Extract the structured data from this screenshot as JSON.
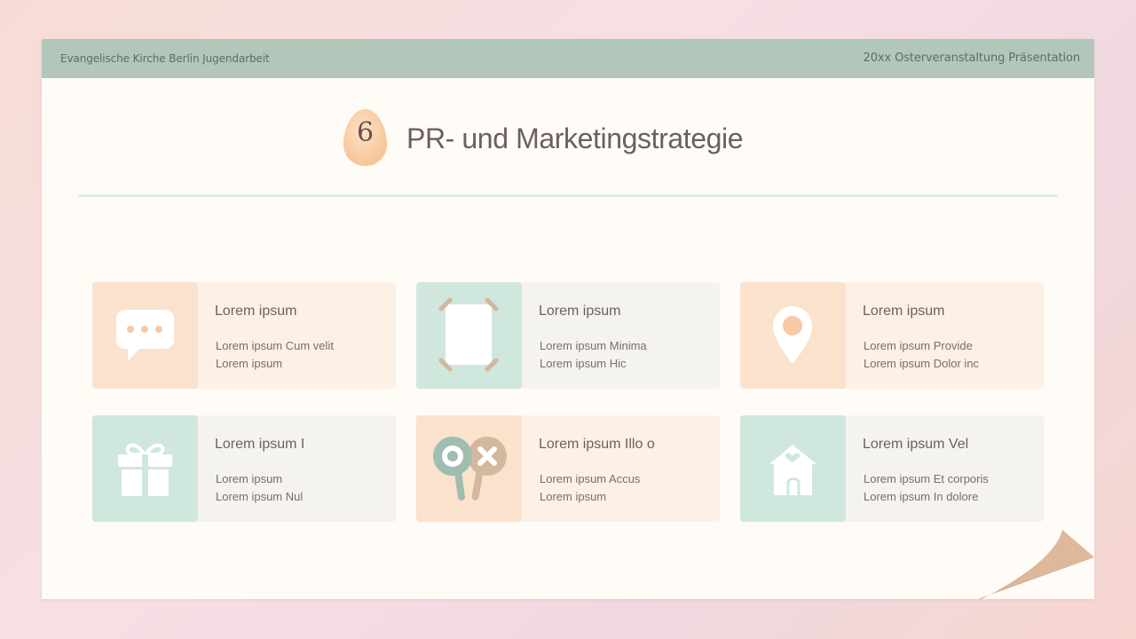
{
  "header": {
    "left": "Evangelische Kirche Berlin Jugendarbeit",
    "right": "20xx Osterveranstaltung Präsentation"
  },
  "section": {
    "number": "6",
    "title": "PR- und Marketingstrategie"
  },
  "cards": [
    {
      "icon": "chat-bubble-icon",
      "title": "Lorem ipsum",
      "line1": "Lorem ipsum Cum velit",
      "line2": "Lorem ipsum"
    },
    {
      "icon": "photo-frame-icon",
      "title": "Lorem ipsum",
      "line1": "Lorem ipsum Minima",
      "line2": "Lorem ipsum Hic"
    },
    {
      "icon": "location-pin-icon",
      "title": "Lorem ipsum",
      "line1": "Lorem ipsum Provide",
      "line2": "Lorem ipsum Dolor inc"
    },
    {
      "icon": "gift-box-icon",
      "title": "Lorem ipsum I",
      "line1": "Lorem ipsum",
      "line2": "Lorem ipsum Nul"
    },
    {
      "icon": "tic-tac-toe-paddles-icon",
      "title": "Lorem ipsum Illo o",
      "line1": "Lorem ipsum Accus",
      "line2": "Lorem ipsum"
    },
    {
      "icon": "house-icon",
      "title": "Lorem ipsum Vel",
      "line1": "Lorem ipsum Et corporis",
      "line2": "Lorem ipsum In dolore"
    }
  ],
  "colors": {
    "header_bar": "#b2c6ba",
    "peach": "#fbe2cc",
    "mint": "#cfe7dd",
    "egg": "#f9cfa4",
    "paper": "#fffbf6"
  }
}
